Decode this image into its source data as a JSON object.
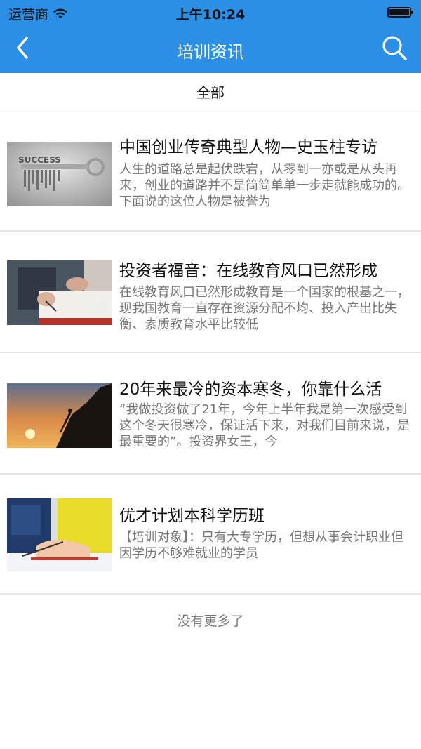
{
  "status_bar": {
    "carrier": "运营商",
    "time": "上午10:24"
  },
  "nav": {
    "title": "培训资讯"
  },
  "filter": {
    "label": "全部"
  },
  "news": [
    {
      "title": "中国创业传奇典型人物—史玉柱专访",
      "summary": "人生的道路总是起伏跌宕，从零到一亦或是从头再来，创业的道路并不是简简单单一步走就能成功的。下面说的这位人物是被誉为",
      "image": "success-key-image",
      "image_text": "SUCCESS"
    },
    {
      "title": "投资者福音：在线教育风口已然形成",
      "summary": "在线教育风口已然形成教育是一个国家的根基之一，现我国教育一直存在资源分配不均、投入产出比失衡、素质教育水平比较低",
      "image": "writing-notebook-image"
    },
    {
      "title": "20年来最冷的资本寒冬，你靠什么活",
      "summary": "“我做投资做了21年，今年上半年我是第一次感受到这个冬天很寒冷，保证活下来，对我们目前来说，是最重要的”。投资界女王，今",
      "image": "climbing-sunset-image"
    },
    {
      "title": "优才计划本科学历班",
      "summary": "【培训对象】：只有大专学历，但想从事会计职业但因学历不够难就业的学员",
      "image": "student-writing-image"
    }
  ],
  "footer": {
    "no_more": "没有更多了"
  },
  "colors": {
    "header": "#2b8fe6",
    "title": "#111111",
    "summary": "#777777"
  }
}
